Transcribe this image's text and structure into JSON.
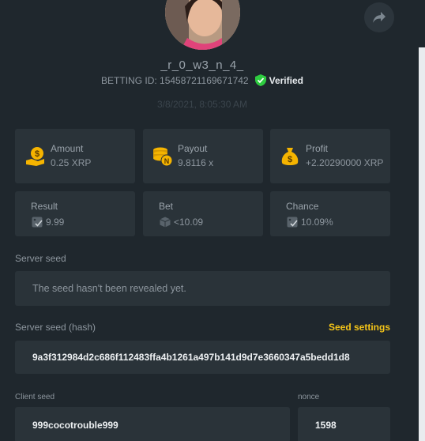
{
  "profile": {
    "username": "_r_0_w3_n_4_",
    "betting_id": "BETTING ID: 15458721169671742",
    "verified_label": "Verified",
    "date": "3/8/2021, 8:05:30 AM"
  },
  "stats": {
    "amount": {
      "label": "Amount",
      "value": "0.25 XRP",
      "icon": "money-bag-hand-icon"
    },
    "payout": {
      "label": "Payout",
      "value": "9.8116 x",
      "icon": "coin-stack-icon"
    },
    "profit": {
      "label": "Profit",
      "value": "+2.20290000 XRP",
      "icon": "money-bag-icon"
    }
  },
  "details": {
    "result": {
      "label": "Result",
      "value": "9.99",
      "icon": "dice-check-icon"
    },
    "bet": {
      "label": "Bet",
      "value": "<10.09",
      "icon": "dice-icon"
    },
    "chance": {
      "label": "Chance",
      "value": "10.09%",
      "icon": "dice-check-icon"
    }
  },
  "server_seed": {
    "label": "Server seed",
    "value": "The seed hasn't been revealed yet."
  },
  "server_seed_hash": {
    "label": "Server seed (hash)",
    "settings_link": "Seed settings",
    "value": "9a3f312984d2c686f112483ffa4b1261a497b141d9d7e3660347a5bedd1d8"
  },
  "client_seed": {
    "label": "Client seed",
    "value": "999cocotrouble999"
  },
  "nonce": {
    "label": "nonce",
    "value": "1598"
  },
  "colors": {
    "background": "#1f272d",
    "card": "#2a3339",
    "accent_gold": "#f5c518",
    "verified_green": "#2ecc40"
  }
}
